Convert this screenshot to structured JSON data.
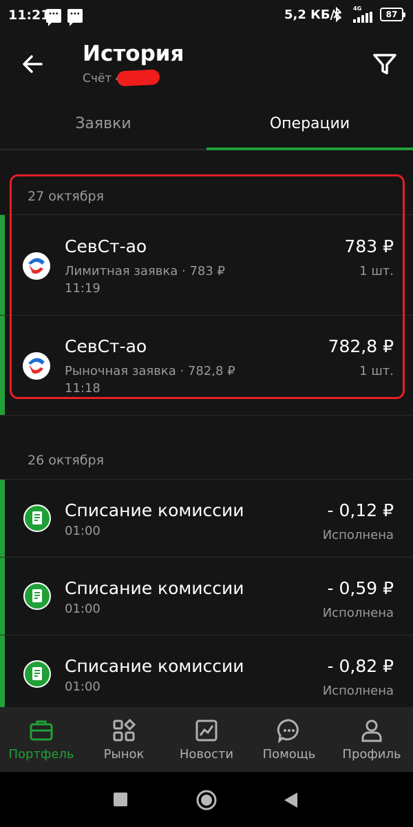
{
  "status_bar": {
    "time": "11:21",
    "net_speed": "5,2 КБ/с",
    "network": "4G",
    "battery": "87"
  },
  "header": {
    "title": "История",
    "account": "Счёт 4"
  },
  "tabs": [
    {
      "label": "Заявки",
      "active": false
    },
    {
      "label": "Операции",
      "active": true
    }
  ],
  "sections": [
    {
      "date": "27 октября",
      "items": [
        {
          "title": "СевСт-ао",
          "subtitle": "Лимитная заявка · 783 ₽",
          "time": "11:19",
          "amount": "783 ₽",
          "right_sub": "1 шт."
        },
        {
          "title": "СевСт-ао",
          "subtitle": "Рыночная заявка · 782,8 ₽",
          "time": "11:18",
          "amount": "782,8 ₽",
          "right_sub": "1 шт."
        }
      ]
    },
    {
      "date": "26 октября",
      "items": [
        {
          "title": "Списание комиссии",
          "time": "01:00",
          "amount": "- 0,12 ₽",
          "right_sub": "Исполнена"
        },
        {
          "title": "Списание комиссии",
          "time": "01:00",
          "amount": "- 0,59 ₽",
          "right_sub": "Исполнена"
        },
        {
          "title": "Списание комиссии",
          "time": "01:00",
          "amount": "- 0,82 ₽",
          "right_sub": "Исполнена"
        }
      ]
    }
  ],
  "bottom_nav": [
    {
      "label": "Портфель",
      "icon": "briefcase-icon",
      "active": true
    },
    {
      "label": "Рынок",
      "icon": "grid-icon",
      "active": false
    },
    {
      "label": "Новости",
      "icon": "chart-icon",
      "active": false
    },
    {
      "label": "Помощь",
      "icon": "chat-icon",
      "active": false
    },
    {
      "label": "Профиль",
      "icon": "person-icon",
      "active": false
    }
  ],
  "colors": {
    "accent": "#21a038",
    "background": "#151515",
    "highlight": "#e81e25",
    "secondary_text": "#9a9a9a"
  }
}
